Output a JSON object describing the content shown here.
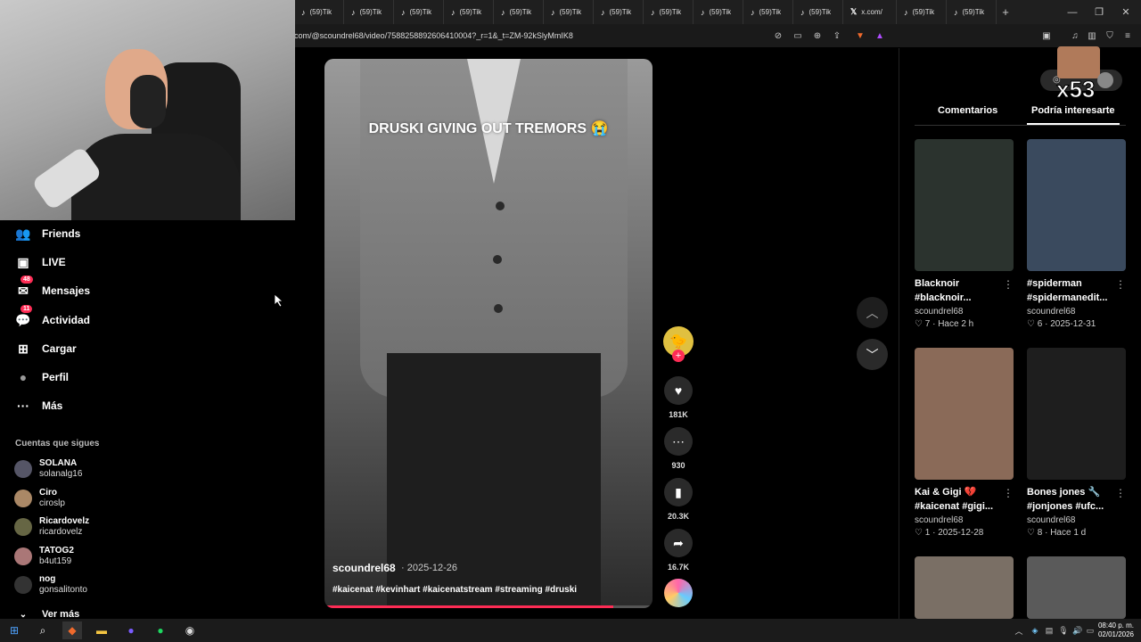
{
  "browser": {
    "tabs": [
      {
        "icon": "tiktok-icon",
        "label": "(59)Tik"
      },
      {
        "icon": "tiktok-icon",
        "label": "(59)Tik"
      },
      {
        "icon": "tiktok-icon",
        "label": "(59)Tik"
      },
      {
        "icon": "tiktok-icon",
        "label": "(59)Tik"
      },
      {
        "icon": "tiktok-icon",
        "label": "(59)Tik"
      },
      {
        "icon": "tiktok-icon",
        "label": "(59)Tik"
      },
      {
        "icon": "tiktok-icon",
        "label": "(59)Tik"
      },
      {
        "icon": "tiktok-icon",
        "label": "(59)Tik"
      },
      {
        "icon": "tiktok-icon",
        "label": "(59)Tik"
      },
      {
        "icon": "tiktok-icon",
        "label": "(59)Tik"
      },
      {
        "icon": "tiktok-icon",
        "label": "(59)Tik"
      },
      {
        "icon": "x-icon",
        "label": "x.com/"
      },
      {
        "icon": "tiktok-icon",
        "label": "(59)Tik"
      },
      {
        "icon": "tiktok-icon",
        "label": "(59)Tik"
      }
    ],
    "new_tab": "+",
    "url": "com/@scoundrel68/video/7588258892606410004?_r=1&_t=ZM-92kSlyMmIK8"
  },
  "stream_overlay": {
    "counter": "x53"
  },
  "nav": {
    "items": [
      {
        "label": "Friends",
        "icon": "friends-icon"
      },
      {
        "label": "LIVE",
        "icon": "live-icon"
      },
      {
        "label": "Mensajes",
        "icon": "messages-icon",
        "badge": "48"
      },
      {
        "label": "Actividad",
        "icon": "activity-icon",
        "badge": "11"
      },
      {
        "label": "Cargar",
        "icon": "upload-icon"
      },
      {
        "label": "Perfil",
        "icon": "profile-icon"
      },
      {
        "label": "Más",
        "icon": "more-icon"
      }
    ],
    "following_title": "Cuentas que sigues",
    "following": [
      {
        "name": "SOLANA",
        "user": "solanalg16"
      },
      {
        "name": "Ciro",
        "user": "ciroslp"
      },
      {
        "name": "Ricardovelz",
        "user": "ricardovelz"
      },
      {
        "name": "TATOG2",
        "user": "b4ut159"
      },
      {
        "name": "nog",
        "user": "gonsalitonto"
      }
    ],
    "see_more": "Ver más"
  },
  "video": {
    "overlay_title": "DRUSKI GIVING OUT TREMORS 😭",
    "author": "scoundrel68",
    "date": "· 2025-12-26",
    "hashtags": "#kaicenat #kevinhart #kaicenatstream #streaming #druski",
    "progress": 0.88
  },
  "actions": {
    "likes": "181K",
    "comments": "930",
    "saves": "20.3K",
    "shares": "16.7K"
  },
  "panel": {
    "tabs": [
      "Comentarios",
      "Podría interesarte"
    ],
    "active_tab": 1,
    "cards": [
      {
        "title": "Blacknoir #blacknoir...",
        "author": "scoundrel68",
        "likes": "7",
        "when": "Hace 2 h",
        "thumb": "#2b332e"
      },
      {
        "title": "#spiderman #spidermanedit...",
        "author": "scoundrel68",
        "likes": "6",
        "when": "2025-12-31",
        "thumb": "#3a4a5e"
      },
      {
        "title": "Kai & Gigi 💔 #kaicenat #gigi...",
        "author": "scoundrel68",
        "likes": "1",
        "when": "2025-12-28",
        "thumb": "#8a6a58"
      },
      {
        "title": "Bones jones 🔧 #jonjones #ufc...",
        "author": "scoundrel68",
        "likes": "8",
        "when": "Hace 1 d",
        "thumb": "#1e1e1e"
      },
      {
        "title": "",
        "author": "",
        "likes": "",
        "when": "",
        "thumb": "#7a6f65"
      },
      {
        "title": "",
        "author": "",
        "likes": "",
        "when": "",
        "thumb": "#5a5a5a"
      }
    ]
  },
  "taskbar": {
    "time": "08:40 p. m.",
    "date": "02/01/2026"
  }
}
